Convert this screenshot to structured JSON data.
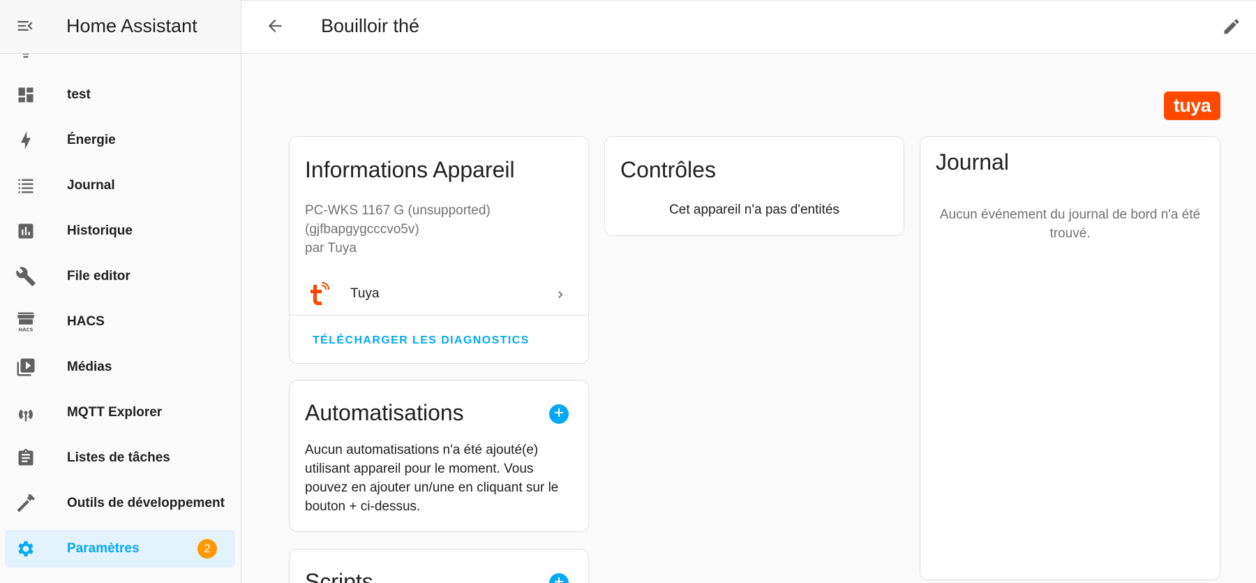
{
  "app": {
    "title": "Home Assistant"
  },
  "sidebar": {
    "items": [
      {
        "label": "",
        "icon": "lightbulb-icon"
      },
      {
        "label": "test",
        "icon": "dashboard-icon"
      },
      {
        "label": "Énergie",
        "icon": "lightning-bolt-icon"
      },
      {
        "label": "Journal",
        "icon": "format-list-bulleted-icon"
      },
      {
        "label": "Historique",
        "icon": "chart-box-icon"
      },
      {
        "label": "File editor",
        "icon": "wrench-icon"
      },
      {
        "label": "HACS",
        "icon": "hacs-store-icon"
      },
      {
        "label": "Médias",
        "icon": "play-box-multiple-icon"
      },
      {
        "label": "MQTT Explorer",
        "icon": "antenna-icon"
      },
      {
        "label": "Listes de tâches",
        "icon": "clipboard-list-icon"
      },
      {
        "label": "Outils de développement",
        "icon": "hammer-icon"
      },
      {
        "label": "Paramètres",
        "icon": "gear-icon",
        "badge": "2",
        "active": true
      }
    ]
  },
  "header": {
    "title": "Bouilloir thé"
  },
  "brand": {
    "logo_text": "tuya",
    "color": "#ff4800"
  },
  "device_info": {
    "title": "Informations Appareil",
    "model_line1": "PC-WKS 1167 G (unsupported)",
    "model_line2": "(gjfbapgygcccvo5v)",
    "manufacturer": "par Tuya",
    "integration": "Tuya",
    "diagnostics_button": "TÉLÉCHARGER LES DIAGNOSTICS"
  },
  "controls": {
    "title": "Contrôles",
    "empty_text": "Cet appareil n'a pas d'entités"
  },
  "logbook": {
    "title": "Journal",
    "empty_text": "Aucun événement du journal de bord n'a été trouvé."
  },
  "automations": {
    "title": "Automatisations",
    "empty_text": "Aucun automatisations n'a été ajouté(e) utilisant appareil pour le moment. Vous pouvez en ajouter un/une en cliquant sur le bouton + ci-dessus."
  },
  "scripts": {
    "title": "Scripts"
  },
  "colors": {
    "primary": "#03a9f4",
    "badge": "#ff9800"
  }
}
